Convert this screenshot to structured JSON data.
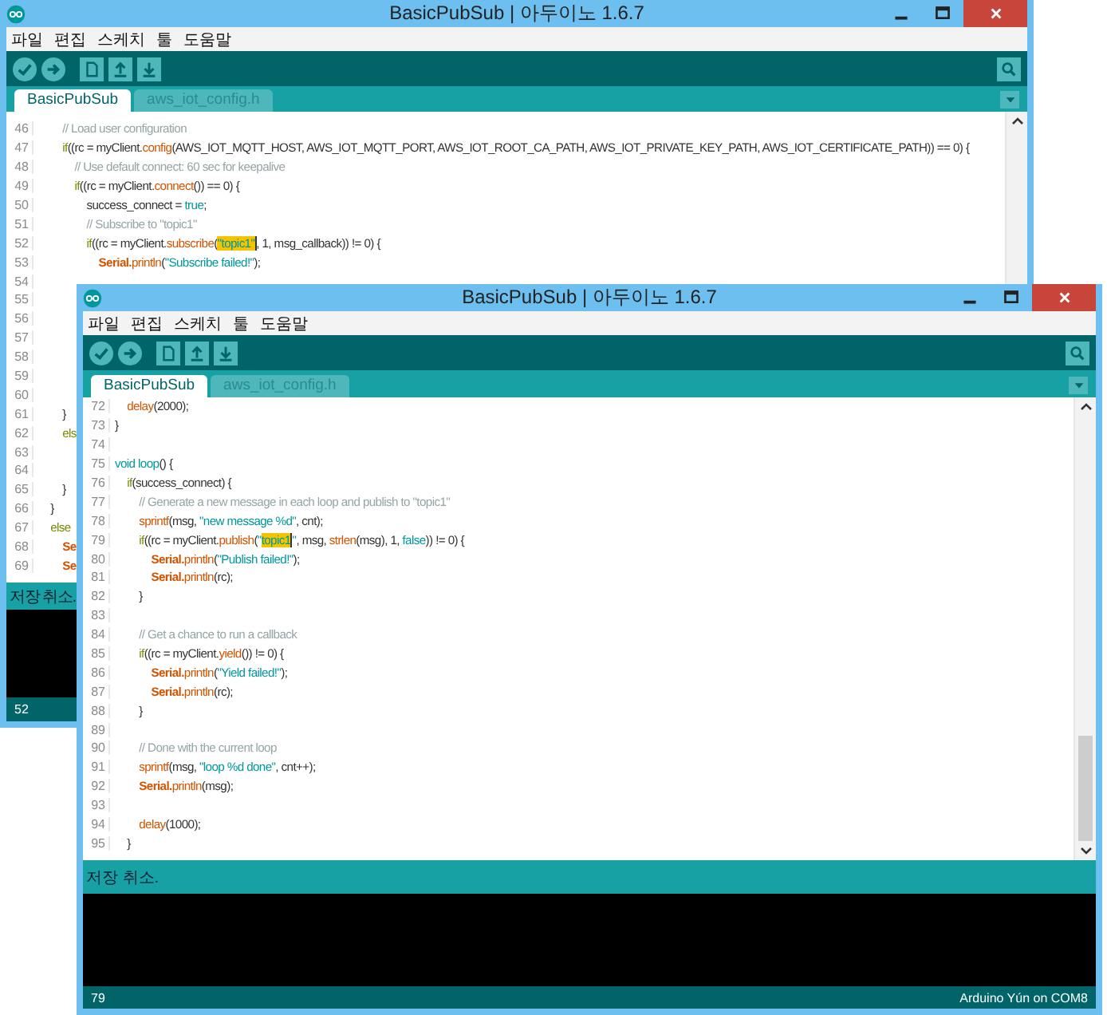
{
  "windows": [
    {
      "title": "BasicPubSub | 아두이노 1.6.7",
      "menu": [
        "파일",
        "편집",
        "스케치",
        "툴",
        "도움말"
      ],
      "toolbar": [
        {
          "kind": "verify"
        },
        {
          "kind": "upload"
        },
        {
          "kind": "new"
        },
        {
          "kind": "open"
        },
        {
          "kind": "save"
        }
      ],
      "tabs": [
        {
          "label": "BasicPubSub",
          "selected": true
        },
        {
          "label": "aws_iot_config.h",
          "selected": false
        }
      ],
      "code_lines": [
        {
          "no": "46",
          "code": [
            {
              "kind": "comment",
              "text": "    // Load user configuration"
            }
          ]
        },
        {
          "no": "47",
          "code": [
            {
              "kind": "keyword",
              "text": "    if"
            },
            {
              "kind": "plain",
              "text": "((rc = myClient."
            },
            {
              "kind": "function",
              "text": "config"
            },
            {
              "kind": "plain",
              "text": "(AWS_IOT_MQTT_HOST, AWS_IOT_MQTT_PORT, AWS_IOT_ROOT_CA_PATH, AWS_IOT_PRIVATE_KEY_PATH, AWS_IOT_CERTIFICATE_PATH)) == 0) {"
            }
          ]
        },
        {
          "no": "48",
          "code": [
            {
              "kind": "comment",
              "text": "      // Use default connect: 60 sec for keepalive"
            }
          ]
        },
        {
          "no": "49",
          "code": [
            {
              "kind": "keyword",
              "text": "      if"
            },
            {
              "kind": "plain",
              "text": "((rc = myClient."
            },
            {
              "kind": "function",
              "text": "connect"
            },
            {
              "kind": "plain",
              "text": "()) == 0) {"
            }
          ]
        },
        {
          "no": "50",
          "code": [
            {
              "kind": "plain",
              "text": "        success_connect = "
            },
            {
              "kind": "literal",
              "text": "true"
            },
            {
              "kind": "plain",
              "text": ";"
            }
          ]
        },
        {
          "no": "51",
          "code": [
            {
              "kind": "comment",
              "text": "        // Subscribe to \"topic1\""
            }
          ]
        },
        {
          "no": "52",
          "code": [
            {
              "kind": "keyword",
              "text": "        if"
            },
            {
              "kind": "plain",
              "text": "((rc = myClient."
            },
            {
              "kind": "function",
              "text": "subscribe"
            },
            {
              "kind": "plain",
              "text": "("
            },
            {
              "kind": "match",
              "text": "\"topic1\""
            },
            {
              "kind": "plain",
              "text": ", 1, msg_callback)) != 0) {"
            }
          ]
        },
        {
          "no": "53",
          "code": [
            {
              "kind": "class",
              "text": "          Serial."
            },
            {
              "kind": "function",
              "text": "println"
            },
            {
              "kind": "plain",
              "text": "("
            },
            {
              "kind": "string",
              "text": "\"Subscribe failed!\""
            },
            {
              "kind": "plain",
              "text": ");"
            }
          ]
        },
        {
          "no": "54"
        },
        {
          "no": "55"
        },
        {
          "no": "56"
        },
        {
          "no": "57"
        },
        {
          "no": "58"
        },
        {
          "no": "59"
        },
        {
          "no": "60"
        },
        {
          "no": "61",
          "code": [
            {
              "kind": "plain",
              "text": "    }"
            }
          ]
        },
        {
          "no": "62",
          "code": [
            {
              "kind": "keyword",
              "text": "    els"
            }
          ]
        },
        {
          "no": "63"
        },
        {
          "no": "64"
        },
        {
          "no": "65",
          "code": [
            {
              "kind": "plain",
              "text": "    }"
            }
          ]
        },
        {
          "no": "66",
          "code": [
            {
              "kind": "plain",
              "text": "  }"
            }
          ]
        },
        {
          "no": "67",
          "code": [
            {
              "kind": "keyword",
              "text": "  else"
            }
          ]
        },
        {
          "no": "68",
          "code": [
            {
              "kind": "class",
              "text": "    Se"
            }
          ]
        },
        {
          "no": "69",
          "code": [
            {
              "kind": "class",
              "text": "    Se"
            }
          ]
        }
      ],
      "status_message": "저장 취소.",
      "footer_line": "52"
    },
    {
      "title": "BasicPubSub | 아두이노 1.6.7",
      "menu": [
        "파일",
        "편집",
        "스케치",
        "툴",
        "도움말"
      ],
      "toolbar": [
        {
          "kind": "verify"
        },
        {
          "kind": "upload"
        },
        {
          "kind": "new"
        },
        {
          "kind": "open"
        },
        {
          "kind": "save"
        }
      ],
      "tabs": [
        {
          "label": "BasicPubSub",
          "selected": true
        },
        {
          "label": "aws_iot_config.h",
          "selected": false
        }
      ],
      "code_lines": [
        {
          "no": "72",
          "code": [
            {
              "kind": "function",
              "text": "  delay"
            },
            {
              "kind": "plain",
              "text": "(2000);"
            }
          ]
        },
        {
          "no": "73",
          "code": [
            {
              "kind": "plain",
              "text": "}"
            }
          ]
        },
        {
          "no": "74"
        },
        {
          "no": "75",
          "code": [
            {
              "kind": "literal",
              "text": "void loop"
            },
            {
              "kind": "plain",
              "text": "() {"
            }
          ]
        },
        {
          "no": "76",
          "code": [
            {
              "kind": "keyword",
              "text": "  if"
            },
            {
              "kind": "plain",
              "text": "(success_connect) {"
            }
          ]
        },
        {
          "no": "77",
          "code": [
            {
              "kind": "comment",
              "text": "    // Generate a new message in each loop and publish to \"topic1\""
            }
          ]
        },
        {
          "no": "78",
          "code": [
            {
              "kind": "function",
              "text": "    sprintf"
            },
            {
              "kind": "plain",
              "text": "(msg, "
            },
            {
              "kind": "string",
              "text": "\"new message %d\""
            },
            {
              "kind": "plain",
              "text": ", cnt);"
            }
          ]
        },
        {
          "no": "79",
          "code": [
            {
              "kind": "keyword",
              "text": "    if"
            },
            {
              "kind": "plain",
              "text": "((rc = myClient."
            },
            {
              "kind": "function",
              "text": "publish"
            },
            {
              "kind": "plain",
              "text": "("
            },
            {
              "kind": "string",
              "text": "\""
            },
            {
              "kind": "match",
              "text": "topic1"
            },
            {
              "kind": "string",
              "text": "\""
            },
            {
              "kind": "plain",
              "text": ", msg, "
            },
            {
              "kind": "function",
              "text": "strlen"
            },
            {
              "kind": "plain",
              "text": "(msg), 1, "
            },
            {
              "kind": "literal",
              "text": "false"
            },
            {
              "kind": "plain",
              "text": ")) != 0) {"
            }
          ]
        },
        {
          "no": "80",
          "code": [
            {
              "kind": "class",
              "text": "      Serial."
            },
            {
              "kind": "function",
              "text": "println"
            },
            {
              "kind": "plain",
              "text": "("
            },
            {
              "kind": "string",
              "text": "\"Publish failed!\""
            },
            {
              "kind": "plain",
              "text": ");"
            }
          ]
        },
        {
          "no": "81",
          "code": [
            {
              "kind": "class",
              "text": "      Serial."
            },
            {
              "kind": "function",
              "text": "println"
            },
            {
              "kind": "plain",
              "text": "(rc);"
            }
          ]
        },
        {
          "no": "82",
          "code": [
            {
              "kind": "plain",
              "text": "    }"
            }
          ]
        },
        {
          "no": "83"
        },
        {
          "no": "84",
          "code": [
            {
              "kind": "comment",
              "text": "    // Get a chance to run a callback"
            }
          ]
        },
        {
          "no": "85",
          "code": [
            {
              "kind": "keyword",
              "text": "    if"
            },
            {
              "kind": "plain",
              "text": "((rc = myClient."
            },
            {
              "kind": "function",
              "text": "yield"
            },
            {
              "kind": "plain",
              "text": "()) != 0) {"
            }
          ]
        },
        {
          "no": "86",
          "code": [
            {
              "kind": "class",
              "text": "      Serial."
            },
            {
              "kind": "function",
              "text": "println"
            },
            {
              "kind": "plain",
              "text": "("
            },
            {
              "kind": "string",
              "text": "\"Yield failed!\""
            },
            {
              "kind": "plain",
              "text": ");"
            }
          ]
        },
        {
          "no": "87",
          "code": [
            {
              "kind": "class",
              "text": "      Serial."
            },
            {
              "kind": "function",
              "text": "println"
            },
            {
              "kind": "plain",
              "text": "(rc);"
            }
          ]
        },
        {
          "no": "88",
          "code": [
            {
              "kind": "plain",
              "text": "    }"
            }
          ]
        },
        {
          "no": "89"
        },
        {
          "no": "90",
          "code": [
            {
              "kind": "comment",
              "text": "    // Done with the current loop"
            }
          ]
        },
        {
          "no": "91",
          "code": [
            {
              "kind": "function",
              "text": "    sprintf"
            },
            {
              "kind": "plain",
              "text": "(msg, "
            },
            {
              "kind": "string",
              "text": "\"loop %d done\""
            },
            {
              "kind": "plain",
              "text": ", cnt++);"
            }
          ]
        },
        {
          "no": "92",
          "code": [
            {
              "kind": "class",
              "text": "    Serial."
            },
            {
              "kind": "function",
              "text": "println"
            },
            {
              "kind": "plain",
              "text": "(msg);"
            }
          ]
        },
        {
          "no": "93"
        },
        {
          "no": "94",
          "code": [
            {
              "kind": "function",
              "text": "    delay"
            },
            {
              "kind": "plain",
              "text": "(1000);"
            }
          ]
        },
        {
          "no": "95",
          "code": [
            {
              "kind": "plain",
              "text": "  }"
            }
          ]
        }
      ],
      "status_message": "저장 취소.",
      "footer_line": "79",
      "footer_board": "Arduino Yún on COM8"
    }
  ]
}
